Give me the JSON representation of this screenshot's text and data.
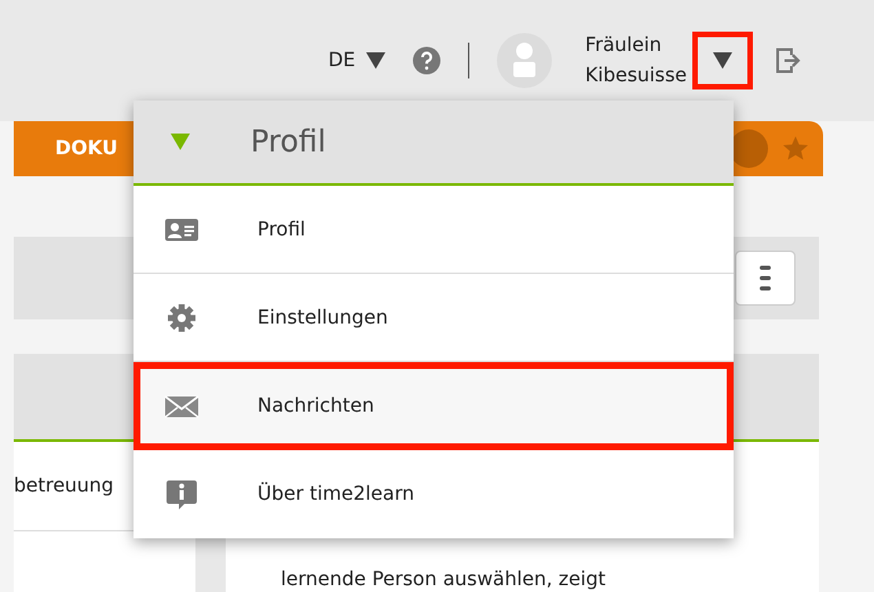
{
  "header": {
    "language": "DE",
    "user_name": [
      "Fräulein",
      "Kibesuisse"
    ],
    "user_menu_toggle": {
      "highlighted": true
    }
  },
  "tab_bar": {
    "tab_label": "DOKU"
  },
  "content": {
    "sidebar_row": "betreuung",
    "body_text": "lernende Person auswählen, zeigt"
  },
  "profile_menu": {
    "title": "Profil",
    "items": [
      {
        "label": "Profil",
        "kind": "profile",
        "highlighted": false
      },
      {
        "label": "Einstellungen",
        "kind": "settings",
        "highlighted": false
      },
      {
        "label": "Nachrichten",
        "kind": "messages",
        "highlighted": true
      },
      {
        "label": "Über time2learn",
        "kind": "info",
        "highlighted": false
      }
    ]
  }
}
